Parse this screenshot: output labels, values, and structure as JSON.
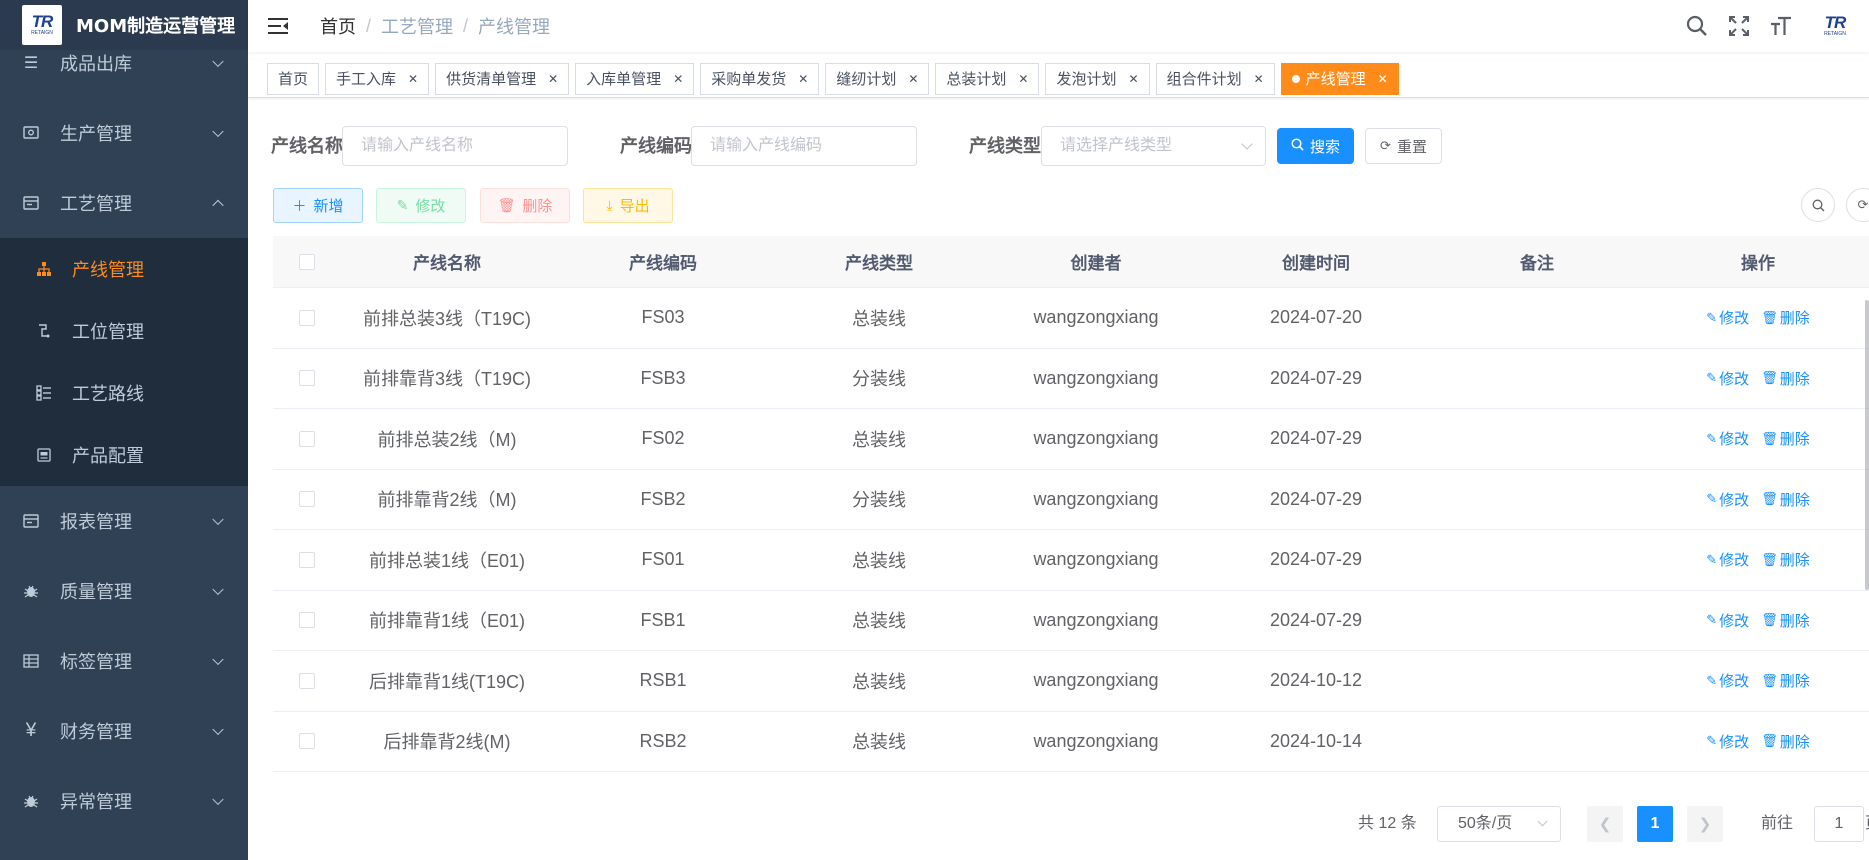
{
  "app": {
    "title": "MOM制造运营管理",
    "logo_text": "TR",
    "logo_sub": "RETAIGN"
  },
  "sidebar": {
    "items": [
      {
        "label": "成品出库",
        "icon": "list-icon"
      },
      {
        "label": "生产管理",
        "icon": "monitor-icon"
      },
      {
        "label": "工艺管理",
        "icon": "form-icon",
        "expanded": true
      }
    ],
    "sub_items": [
      {
        "label": "产线管理",
        "icon": "tree-icon",
        "active": true
      },
      {
        "label": "工位管理",
        "icon": "station-icon"
      },
      {
        "label": "工艺路线",
        "icon": "route-icon"
      },
      {
        "label": "产品配置",
        "icon": "config-icon"
      }
    ],
    "items_after": [
      {
        "label": "报表管理",
        "icon": "report-icon"
      },
      {
        "label": "质量管理",
        "icon": "bug-icon"
      },
      {
        "label": "标签管理",
        "icon": "table-icon"
      },
      {
        "label": "财务管理",
        "icon": "yen-icon"
      },
      {
        "label": "异常管理",
        "icon": "bug-icon"
      }
    ]
  },
  "navbar": {
    "breadcrumb": [
      "首页",
      "工艺管理",
      "产线管理"
    ]
  },
  "tags": [
    {
      "label": "首页",
      "closable": false
    },
    {
      "label": "手工入库",
      "closable": true
    },
    {
      "label": "供货清单管理",
      "closable": true
    },
    {
      "label": "入库单管理",
      "closable": true
    },
    {
      "label": "采购单发货",
      "closable": true
    },
    {
      "label": "缝纫计划",
      "closable": true
    },
    {
      "label": "总装计划",
      "closable": true
    },
    {
      "label": "发泡计划",
      "closable": true
    },
    {
      "label": "组合件计划",
      "closable": true
    },
    {
      "label": "产线管理",
      "closable": true,
      "active": true
    }
  ],
  "search": {
    "name_label": "产线名称",
    "name_placeholder": "请输入产线名称",
    "code_label": "产线编码",
    "code_placeholder": "请输入产线编码",
    "type_label": "产线类型",
    "type_placeholder": "请选择产线类型",
    "search_btn": "搜索",
    "reset_btn": "重置"
  },
  "toolbar": {
    "add": "新增",
    "edit": "修改",
    "delete": "删除",
    "export": "导出"
  },
  "table": {
    "columns": [
      "产线名称",
      "产线编码",
      "产线类型",
      "创建者",
      "创建时间",
      "备注",
      "操作"
    ],
    "rows": [
      {
        "name": "前排总装3线（T19C)",
        "code": "FS03",
        "type": "总装线",
        "creator": "wangzongxiang",
        "time": "2024-07-20",
        "remark": ""
      },
      {
        "name": "前排靠背3线（T19C)",
        "code": "FSB3",
        "type": "分装线",
        "creator": "wangzongxiang",
        "time": "2024-07-29",
        "remark": ""
      },
      {
        "name": "前排总装2线（M)",
        "code": "FS02",
        "type": "总装线",
        "creator": "wangzongxiang",
        "time": "2024-07-29",
        "remark": ""
      },
      {
        "name": "前排靠背2线（M)",
        "code": "FSB2",
        "type": "分装线",
        "creator": "wangzongxiang",
        "time": "2024-07-29",
        "remark": ""
      },
      {
        "name": "前排总装1线（E01)",
        "code": "FS01",
        "type": "总装线",
        "creator": "wangzongxiang",
        "time": "2024-07-29",
        "remark": ""
      },
      {
        "name": "前排靠背1线（E01)",
        "code": "FSB1",
        "type": "总装线",
        "creator": "wangzongxiang",
        "time": "2024-07-29",
        "remark": ""
      },
      {
        "name": "后排靠背1线(T19C)",
        "code": "RSB1",
        "type": "总装线",
        "creator": "wangzongxiang",
        "time": "2024-10-12",
        "remark": ""
      },
      {
        "name": "后排靠背2线(M)",
        "code": "RSB2",
        "type": "总装线",
        "creator": "wangzongxiang",
        "time": "2024-10-14",
        "remark": ""
      }
    ],
    "op_edit": "修改",
    "op_delete": "删除"
  },
  "pagination": {
    "total": "共 12 条",
    "page_size": "50条/页",
    "current": "1",
    "goto_label": "前往",
    "goto_value": "1",
    "goto_unit": "页"
  },
  "colors": {
    "accent": "#1890ff",
    "active_tag": "#ff8c1a",
    "sidebar": "#304156"
  }
}
